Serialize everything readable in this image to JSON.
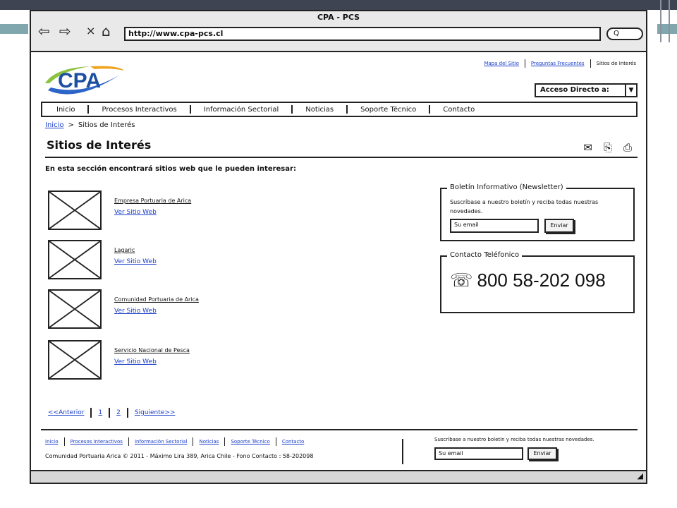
{
  "browser": {
    "title": "CPA - PCS",
    "url": "http://www.cpa-pcs.cl",
    "back_icon": "back-arrow-icon",
    "forward_icon": "forward-arrow-icon",
    "close_glyph": "×",
    "search_glyph": "Q"
  },
  "logo": {
    "text": "CPA"
  },
  "top_links": {
    "site_map": "Mapa del Sitio",
    "faq": "Preguntas Frecuentes",
    "interest_sites": "Sitios de Interés"
  },
  "quick_access": {
    "label": "Acceso Directo a:",
    "arrow": "▼"
  },
  "menu": {
    "items": [
      "Inicio",
      "Procesos Interactivos",
      "Información Sectorial",
      "Noticias",
      "Soporte Técnico",
      "Contacto"
    ]
  },
  "breadcrumb": {
    "home": "Inicio",
    "sep": ">",
    "current": "Sitios de Interés"
  },
  "page": {
    "title": "Sitios de Interés",
    "intro": "En esta sección encontrará sitios web que le pueden interesar:"
  },
  "sites": [
    {
      "name": "Empresa Portuaria de Arica",
      "link": "Ver Sitio Web"
    },
    {
      "name": "Lagaric",
      "link": "Ver Sitio Web"
    },
    {
      "name": "Comunidad Portuaria de Arica",
      "link": "Ver Sitio Web"
    },
    {
      "name": "Servicio Nacional de Pesca",
      "link": "Ver Sitio Web"
    }
  ],
  "newsletter": {
    "legend": "Boletín Informativo (Newsletter)",
    "text": "Suscríbase a nuestro boletín y reciba todas nuestras novedades.",
    "placeholder": "Su email",
    "button": "Enviar"
  },
  "phone_contact": {
    "legend": "Contacto Teléfonico",
    "number": "800 58-202 098",
    "icon": "☏"
  },
  "pagination": {
    "prev": "<<Anterior",
    "page1": "1",
    "page2": "2",
    "next": "Siguiente>>"
  },
  "footer": {
    "links": [
      "Inicio",
      "Procesos Interactivos",
      "Información Sectorial",
      "Noticias",
      "Soporte Técnico",
      "Contacto"
    ],
    "copyright": "Comunidad Portuaria Arica © 2011 - Máximo Lira 389, Arica Chile - Fono Contacto : 58-202098",
    "news_text": "Suscríbase a nuestro boletín y reciba todas nuestras novedades.",
    "placeholder": "Su email",
    "button": "Enviar"
  }
}
